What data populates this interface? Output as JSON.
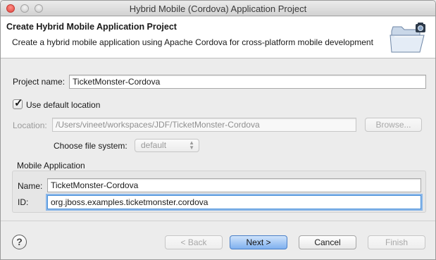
{
  "window": {
    "title": "Hybrid Mobile (Cordova) Application Project"
  },
  "banner": {
    "title": "Create Hybrid Mobile Application Project",
    "description": "Create a hybrid mobile application using Apache Cordova for cross-platform mobile development",
    "icon": "folder-wizard-icon"
  },
  "form": {
    "project_name_label": "Project name:",
    "project_name_value": "TicketMonster-Cordova",
    "use_default_location_label": "Use default location",
    "use_default_location_checked": true,
    "location_label": "Location:",
    "location_value": "/Users/vineet/workspaces/JDF/TicketMonster-Cordova",
    "browse_label": "Browse...",
    "file_system_label": "Choose file system:",
    "file_system_value": "default"
  },
  "mobile_application": {
    "group_label": "Mobile Application",
    "name_label": "Name:",
    "name_value": "TicketMonster-Cordova",
    "id_label": "ID:",
    "id_value": "org.jboss.examples.ticketmonster.cordova"
  },
  "buttons": {
    "help_glyph": "?",
    "back": "< Back",
    "next": "Next >",
    "cancel": "Cancel",
    "finish": "Finish"
  },
  "colors": {
    "default_button": "#7fb0ef",
    "focus_ring": "#8bb8ea",
    "close_button": "#e0443e"
  }
}
